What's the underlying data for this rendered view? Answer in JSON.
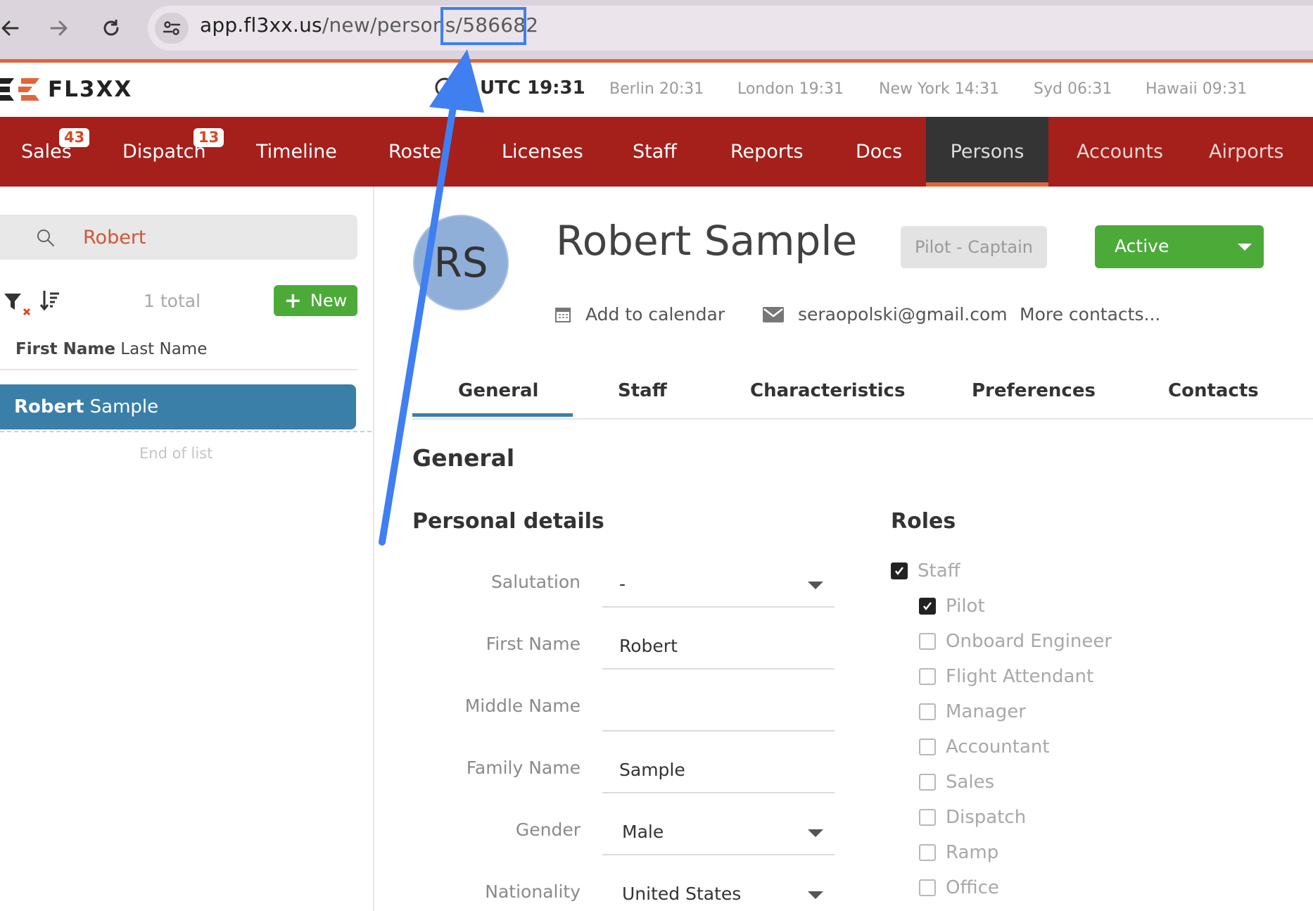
{
  "browser": {
    "url_host": "app.fl3xx.us",
    "url_path": "/new/persons/",
    "url_id": "586682"
  },
  "header": {
    "logo_text": "FL3XX",
    "utc_clock": "UTC 19:31",
    "clocks": [
      "Berlin 20:31",
      "London 19:31",
      "New York 14:31",
      "Syd 06:31",
      "Hawaii 09:31"
    ]
  },
  "nav": {
    "items": [
      {
        "label": "Sales",
        "badge": "43"
      },
      {
        "label": "Dispatch",
        "badge": "13"
      },
      {
        "label": "Timeline"
      },
      {
        "label": "Roste"
      },
      {
        "label": "Licenses"
      },
      {
        "label": "Staff"
      },
      {
        "label": "Reports"
      },
      {
        "label": "Docs"
      },
      {
        "label": "Persons"
      },
      {
        "label": "Accounts"
      },
      {
        "label": "Airports"
      }
    ],
    "active": "Persons"
  },
  "list": {
    "search_value": "Robert",
    "total": "1 total",
    "new_label": "New",
    "column_first": "First Name",
    "column_last": "Last Name",
    "item_first": "Robert",
    "item_last": "Sample",
    "end_label": "End of list"
  },
  "person": {
    "initials": "RS",
    "name": "Robert Sample",
    "role_badge": "Pilot - Captain",
    "status": "Active",
    "add_calendar": "Add to calendar",
    "email": "seraopolski@gmail.com",
    "more_contacts": "More contacts..."
  },
  "tabs": [
    "General",
    "Staff",
    "Characteristics",
    "Preferences",
    "Contacts"
  ],
  "section_title": "General",
  "personal_details": {
    "title": "Personal details",
    "fields": [
      {
        "label": "Salutation",
        "value": "-"
      },
      {
        "label": "First Name",
        "value": "Robert"
      },
      {
        "label": "Middle Name",
        "value": ""
      },
      {
        "label": "Family Name",
        "value": "Sample"
      },
      {
        "label": "Gender",
        "value": "Male"
      },
      {
        "label": "Nationality",
        "value": "United States"
      }
    ]
  },
  "roles": {
    "title": "Roles",
    "items": [
      {
        "label": "Staff",
        "checked": true
      },
      {
        "label": "Pilot",
        "checked": true
      },
      {
        "label": "Onboard Engineer",
        "checked": false
      },
      {
        "label": "Flight Attendant",
        "checked": false
      },
      {
        "label": "Manager",
        "checked": false
      },
      {
        "label": "Accountant",
        "checked": false
      },
      {
        "label": "Sales",
        "checked": false
      },
      {
        "label": "Dispatch",
        "checked": false
      },
      {
        "label": "Ramp",
        "checked": false
      },
      {
        "label": "Office",
        "checked": false
      }
    ]
  },
  "colors": {
    "nav_bg": "#a51f1b",
    "accent_orange": "#e0663a",
    "active_green": "#4caa39",
    "selected_blue": "#3a7fa8",
    "annotation_blue": "#3f7ff0"
  }
}
